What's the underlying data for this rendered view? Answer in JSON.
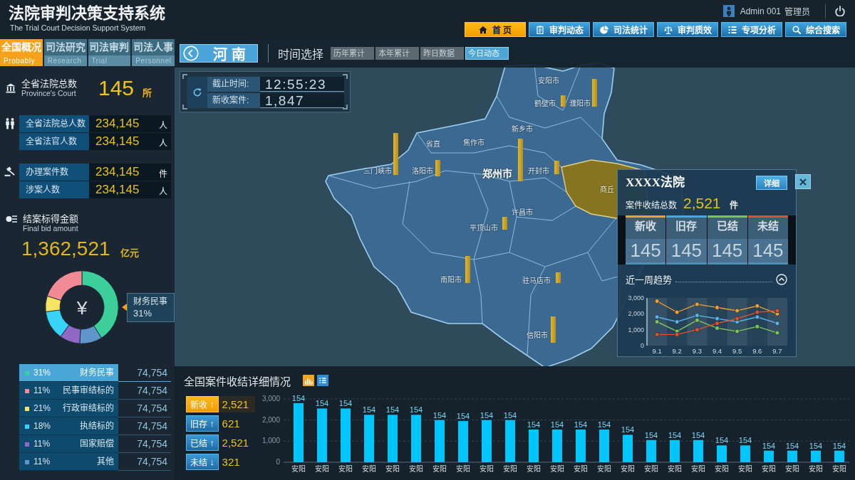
{
  "header": {
    "title": "法院审判决策支持系统",
    "subtitle": "The Trial Court Decision Support System",
    "user": {
      "name": "Admin 001",
      "role": "管理员"
    },
    "nav": [
      {
        "label": "首 页",
        "selected": true
      },
      {
        "label": "审判动态",
        "selected": false
      },
      {
        "label": "司法统计",
        "selected": false
      },
      {
        "label": "审判质效",
        "selected": false
      },
      {
        "label": "专项分析",
        "selected": false
      },
      {
        "label": "综合搜索",
        "selected": false
      }
    ]
  },
  "sidebar": {
    "tabs": [
      {
        "label": "全国概况",
        "sublabel": "Probably",
        "selected": true
      },
      {
        "label": "司法研究",
        "sublabel": "Research",
        "selected": false
      },
      {
        "label": "司法审判",
        "sublabel": "Trial",
        "selected": false
      },
      {
        "label": "司法人事",
        "sublabel": "Personnel",
        "selected": false
      }
    ],
    "court_total": {
      "label": "全省法院总数",
      "sublabel": "Province's Court",
      "value": "145",
      "unit": "所"
    },
    "stat_groups": [
      {
        "rows": [
          {
            "label": "全省法院总人数",
            "value": "234,145",
            "unit": "人"
          },
          {
            "label": "全省法官人数",
            "value": "234,145",
            "unit": "人"
          }
        ]
      },
      {
        "rows": [
          {
            "label": "办理案件数",
            "value": "234,145",
            "unit": "件"
          },
          {
            "label": "涉案人数",
            "value": "234,145",
            "unit": "人"
          }
        ]
      }
    ],
    "bid_amount": {
      "label": "结案标得金额",
      "sublabel": "Final bid amount",
      "value": "1,362,521",
      "unit": "亿元"
    },
    "donut": {
      "center_symbol": "¥",
      "tooltip": {
        "label": "财务民事",
        "value": "31%"
      },
      "chart_data": {
        "type": "donut",
        "values": [
          41,
          20,
          7,
          13,
          9,
          10
        ]
      }
    },
    "legend": [
      {
        "percent": "31%",
        "label": "财务民事",
        "value": "74,754",
        "color": "#3ccf9b",
        "selected": true
      },
      {
        "percent": "11%",
        "label": "民事审结标的",
        "value": "74,754",
        "color": "#f28b95",
        "selected": false
      },
      {
        "percent": "21%",
        "label": "行政审结标的",
        "value": "74,754",
        "color": "#f7e463",
        "selected": false
      },
      {
        "percent": "18%",
        "label": "执结标的",
        "value": "74,754",
        "color": "#38d3f7",
        "selected": false
      },
      {
        "percent": "11%",
        "label": "国家赔偿",
        "value": "74,754",
        "color": "#9068c8",
        "selected": false
      },
      {
        "percent": "11%",
        "label": "其他",
        "value": "74,754",
        "color": "#5f97cc",
        "selected": false
      }
    ]
  },
  "map": {
    "region_button": "河南",
    "time_label": "时间选择",
    "time_tabs": [
      {
        "label": "历年累计",
        "selected": false
      },
      {
        "label": "本年累计",
        "selected": false
      },
      {
        "label": "昨日数据",
        "selected": false
      },
      {
        "label": "今日动态",
        "selected": true
      }
    ],
    "update_panel": [
      {
        "label": "截止时间:",
        "value": "12:55:23"
      },
      {
        "label": "新收案件:",
        "value": "1,847"
      }
    ],
    "cities": [
      {
        "name": "安阳市",
        "kind": "city",
        "selected": false
      },
      {
        "name": "鹤壁市",
        "kind": "city",
        "selected": false
      },
      {
        "name": "濮阳市",
        "kind": "city",
        "selected": false
      },
      {
        "name": "新乡市",
        "kind": "city",
        "selected": false
      },
      {
        "name": "焦作市",
        "kind": "city",
        "selected": false
      },
      {
        "name": "省直",
        "kind": "city",
        "selected": false
      },
      {
        "name": "三门峡市",
        "kind": "city",
        "selected": false
      },
      {
        "name": "洛阳市",
        "kind": "city",
        "selected": false
      },
      {
        "name": "郑州市",
        "kind": "capital",
        "selected": false
      },
      {
        "name": "开封市",
        "kind": "city",
        "selected": false
      },
      {
        "name": "商丘",
        "kind": "city",
        "selected": true
      },
      {
        "name": "许昌市",
        "kind": "city",
        "selected": false
      },
      {
        "name": "平顶山市",
        "kind": "city",
        "selected": false
      },
      {
        "name": "南阳市",
        "kind": "city",
        "selected": false
      },
      {
        "name": "驻马店市",
        "kind": "city",
        "selected": false
      },
      {
        "name": "信阳市",
        "kind": "city",
        "selected": false
      }
    ]
  },
  "court_popup": {
    "title": "XXXX法院",
    "detail_button": "详细",
    "total_label": "案件收结总数",
    "total_value": "2,521",
    "total_unit": "件",
    "stats": [
      {
        "label": "新收",
        "value": "145",
        "color": "#f0a030"
      },
      {
        "label": "旧存",
        "value": "145",
        "color": "#4aa8e0"
      },
      {
        "label": "已结",
        "value": "145",
        "color": "#7cc35a"
      },
      {
        "label": "未结",
        "value": "145",
        "color": "#e0502c"
      }
    ],
    "trend_title": "近一周趋势",
    "chart_data": {
      "type": "line",
      "categories": [
        "9.1",
        "9.2",
        "9.3",
        "9.4",
        "9.5",
        "9.6",
        "9.7"
      ],
      "ylim": [
        0,
        3000
      ],
      "yticks": [
        0,
        {
          "value": 1000,
          "label": "1,000"
        },
        {
          "value": 2000,
          "label": "2,000"
        },
        {
          "value": 3000,
          "label": "3,000"
        }
      ],
      "series": [
        {
          "color": "#f0a030",
          "marker": "circle",
          "values": [
            2800,
            2100,
            2600,
            2400,
            2200,
            2500,
            2000
          ]
        },
        {
          "color": "#5ab4e8",
          "marker": "circle",
          "values": [
            1800,
            1500,
            1900,
            1700,
            1500,
            1800,
            1400
          ]
        },
        {
          "color": "#7cc35a",
          "marker": "circle",
          "values": [
            1500,
            900,
            1600,
            1100,
            900,
            1200,
            800
          ]
        },
        {
          "color": "#e0502c",
          "marker": "circle",
          "values": [
            700,
            700,
            1000,
            1400,
            1700,
            2100,
            2200
          ]
        }
      ]
    }
  },
  "case_summary": {
    "title": "全国案件收结详细情况",
    "views": [
      {
        "selected": true
      },
      {
        "selected": false
      }
    ],
    "stats": [
      {
        "label": "新收",
        "arrow": "↑",
        "value": "2,521",
        "selected": true
      },
      {
        "label": "旧存",
        "arrow": "↑",
        "value": "621",
        "selected": false
      },
      {
        "label": "已结",
        "arrow": "↑",
        "value": "2,521",
        "selected": false
      },
      {
        "label": "未结",
        "arrow": "↓",
        "value": "321",
        "selected": false
      }
    ],
    "chart_data": {
      "type": "bar",
      "categories": [
        "安阳",
        "安阳",
        "安阳",
        "安阳",
        "安阳",
        "安阳",
        "安阳",
        "安阳",
        "安阳",
        "安阳",
        "安阳",
        "安阳",
        "安阳",
        "安阳",
        "安阳",
        "安阳",
        "安阳",
        "安阳",
        "安阳",
        "安阳",
        "安阳",
        "安阳",
        "安阳",
        "安阳"
      ],
      "values": [
        2800,
        2550,
        2550,
        2250,
        2250,
        2250,
        2000,
        1950,
        2000,
        2000,
        1550,
        1550,
        1550,
        1550,
        1300,
        1050,
        1050,
        1050,
        800,
        800,
        550,
        550,
        550,
        550
      ],
      "ylim": [
        0,
        3000
      ],
      "yticks": [
        0,
        {
          "value": 1000,
          "label": "1,000"
        },
        {
          "value": 2000,
          "label": "2,000"
        },
        {
          "value": 3000,
          "label": "3,000"
        }
      ]
    },
    "bar_labels": [
      "154",
      "154",
      "154",
      "154",
      "154",
      "154",
      "154",
      "154",
      "154",
      "154",
      "154",
      "154",
      "154",
      "154",
      "154",
      "154",
      "154",
      "154",
      "154",
      "154",
      "154",
      "154",
      "154",
      "154"
    ]
  }
}
